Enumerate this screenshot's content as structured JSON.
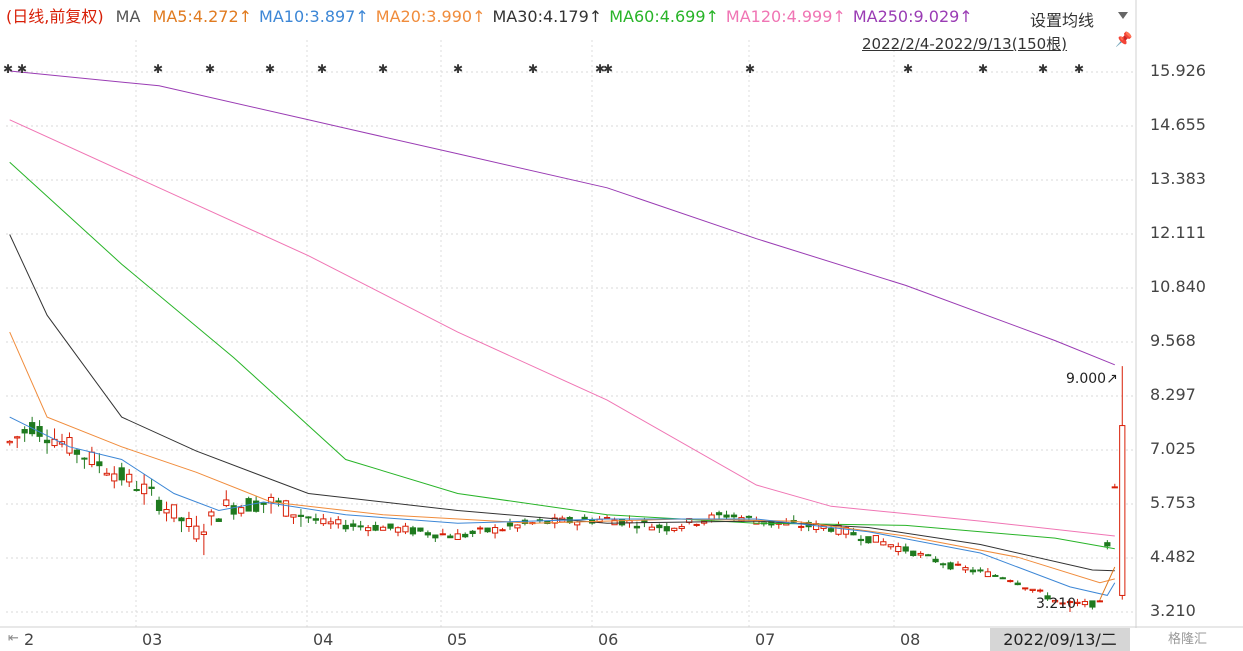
{
  "legend": {
    "period": "(日线,前复权)",
    "ma_label": "MA",
    "ma_items": [
      {
        "text": "MA5:4.272↑",
        "color": "#e07b20"
      },
      {
        "text": "MA10:3.897↑",
        "color": "#3d87d6"
      },
      {
        "text": "MA20:3.990↑",
        "color": "#f08c3c"
      },
      {
        "text": "MA30:4.179↑",
        "color": "#333333"
      },
      {
        "text": "MA60:4.699↑",
        "color": "#28b428"
      },
      {
        "text": "MA120:4.999↑",
        "color": "#f075b4"
      },
      {
        "text": "MA250:9.029↑",
        "color": "#9a3cb4"
      }
    ]
  },
  "toolbar": {
    "settings_label": "设置均线",
    "range_label": "2022/2/4-2022/9/13(150根)",
    "pin_icon": "pin-icon"
  },
  "annotations": {
    "max_label": "9.000↗",
    "min_label": "3.210"
  },
  "cursor_date": "2022/09/13/二",
  "brand": "格隆汇",
  "colors": {
    "up": "#d81e06",
    "down": "#1f7a1f",
    "grid": "#d8d8d8"
  },
  "chart_data": {
    "type": "candlestick",
    "title": "",
    "y_ticks": [
      "15.926",
      "14.655",
      "13.383",
      "12.111",
      "10.840",
      "9.568",
      "8.297",
      "7.025",
      "5.753",
      "4.482",
      "3.210"
    ],
    "ylim": [
      2.85,
      16.3
    ],
    "x_labels": [
      "2",
      "03",
      "04",
      "05",
      "06",
      "07",
      "08"
    ],
    "bars": 150,
    "ohlc_keypoints": [
      {
        "i": 0,
        "close": 7.2
      },
      {
        "i": 3,
        "close": 7.6
      },
      {
        "i": 10,
        "close": 6.9
      },
      {
        "i": 18,
        "close": 6.1
      },
      {
        "i": 25,
        "close": 5.1
      },
      {
        "i": 29,
        "close": 5.7
      },
      {
        "i": 35,
        "close": 5.8
      },
      {
        "i": 42,
        "close": 5.3
      },
      {
        "i": 50,
        "close": 5.2
      },
      {
        "i": 60,
        "close": 5.0
      },
      {
        "i": 70,
        "close": 5.3
      },
      {
        "i": 80,
        "close": 5.4
      },
      {
        "i": 88,
        "close": 5.2
      },
      {
        "i": 96,
        "close": 5.5
      },
      {
        "i": 102,
        "close": 5.3
      },
      {
        "i": 110,
        "close": 5.2
      },
      {
        "i": 118,
        "close": 4.8
      },
      {
        "i": 126,
        "close": 4.3
      },
      {
        "i": 134,
        "close": 4.0
      },
      {
        "i": 141,
        "close": 3.4
      },
      {
        "i": 146,
        "close": 3.4
      },
      {
        "i": 149,
        "close": 7.6
      }
    ],
    "last_candle": {
      "open": 3.6,
      "close": 7.6,
      "high": 9.0,
      "low": 3.5
    },
    "min_price": 3.21,
    "max_price": 9.0,
    "ma_lines": [
      {
        "name": "MA250",
        "color": "#9a3cb4",
        "values": [
          [
            0,
            15.95
          ],
          [
            20,
            15.6
          ],
          [
            40,
            14.8
          ],
          [
            60,
            14.0
          ],
          [
            80,
            13.2
          ],
          [
            100,
            12.0
          ],
          [
            120,
            10.9
          ],
          [
            140,
            9.6
          ],
          [
            148,
            9.03
          ]
        ]
      },
      {
        "name": "MA120",
        "color": "#f075b4",
        "values": [
          [
            0,
            14.8
          ],
          [
            20,
            13.2
          ],
          [
            40,
            11.6
          ],
          [
            60,
            9.8
          ],
          [
            80,
            8.2
          ],
          [
            100,
            6.2
          ],
          [
            110,
            5.7
          ],
          [
            130,
            5.35
          ],
          [
            148,
            5.0
          ]
        ]
      },
      {
        "name": "MA60",
        "color": "#28b428",
        "values": [
          [
            0,
            13.8
          ],
          [
            15,
            11.4
          ],
          [
            30,
            9.2
          ],
          [
            45,
            6.8
          ],
          [
            60,
            6.0
          ],
          [
            80,
            5.5
          ],
          [
            100,
            5.3
          ],
          [
            120,
            5.25
          ],
          [
            140,
            4.95
          ],
          [
            148,
            4.7
          ]
        ]
      },
      {
        "name": "MA30",
        "color": "#333333",
        "values": [
          [
            0,
            12.1
          ],
          [
            5,
            10.2
          ],
          [
            15,
            7.8
          ],
          [
            25,
            7.0
          ],
          [
            40,
            6.0
          ],
          [
            60,
            5.6
          ],
          [
            80,
            5.3
          ],
          [
            100,
            5.35
          ],
          [
            115,
            5.2
          ],
          [
            130,
            4.8
          ],
          [
            145,
            4.2
          ],
          [
            148,
            4.18
          ]
        ]
      },
      {
        "name": "MA20",
        "color": "#f08c3c",
        "values": [
          [
            0,
            9.8
          ],
          [
            5,
            7.8
          ],
          [
            15,
            7.1
          ],
          [
            25,
            6.5
          ],
          [
            35,
            5.8
          ],
          [
            50,
            5.5
          ],
          [
            70,
            5.3
          ],
          [
            90,
            5.4
          ],
          [
            105,
            5.35
          ],
          [
            120,
            5.0
          ],
          [
            135,
            4.5
          ],
          [
            146,
            3.9
          ],
          [
            148,
            3.99
          ]
        ]
      },
      {
        "name": "MA10",
        "color": "#3d87d6",
        "values": [
          [
            0,
            7.8
          ],
          [
            8,
            7.1
          ],
          [
            15,
            6.8
          ],
          [
            22,
            6.0
          ],
          [
            28,
            5.6
          ],
          [
            34,
            5.8
          ],
          [
            45,
            5.5
          ],
          [
            60,
            5.3
          ],
          [
            80,
            5.4
          ],
          [
            100,
            5.4
          ],
          [
            115,
            5.1
          ],
          [
            130,
            4.6
          ],
          [
            142,
            3.8
          ],
          [
            147,
            3.6
          ],
          [
            148,
            3.9
          ]
        ]
      },
      {
        "name": "MA5",
        "color": "#e07b20",
        "values": [
          [
            146,
            3.5
          ],
          [
            148,
            4.27
          ]
        ]
      }
    ]
  }
}
